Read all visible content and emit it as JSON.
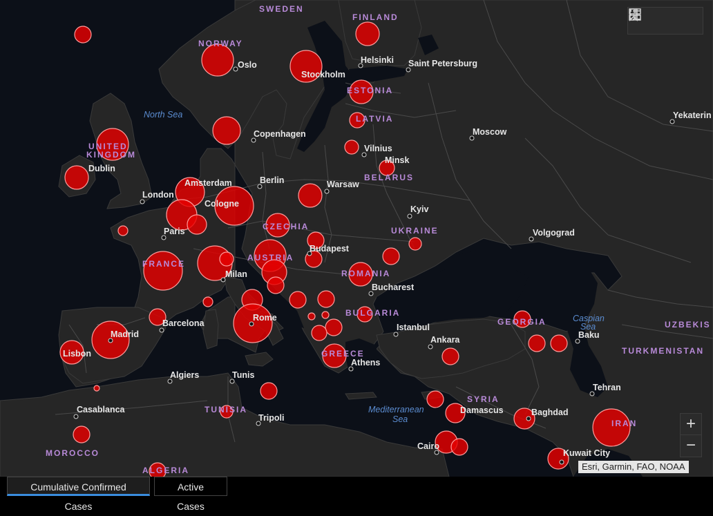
{
  "map": {
    "countries": [
      {
        "name": "SWEDEN"
      },
      {
        "name": "FINLAND"
      },
      {
        "name": "NORWAY"
      },
      {
        "name": "ESTONIA"
      },
      {
        "name": "LATVIA"
      },
      {
        "name": "UNITED"
      },
      {
        "name": "KINGDOM"
      },
      {
        "name": "BELARUS"
      },
      {
        "name": "UKRAINE"
      },
      {
        "name": "CZECHIA"
      },
      {
        "name": "AUSTRIA"
      },
      {
        "name": "FRANCE"
      },
      {
        "name": "ROMANIA"
      },
      {
        "name": "BULGARIA"
      },
      {
        "name": "GREECE"
      },
      {
        "name": "GEORGIA"
      },
      {
        "name": "UZBEKIS"
      },
      {
        "name": "TURKMENISTAN"
      },
      {
        "name": "SYRIA"
      },
      {
        "name": "TUNISIA"
      },
      {
        "name": "MOROCCO"
      },
      {
        "name": "IRAN"
      },
      {
        "name": "ALGERIA"
      }
    ],
    "cities": [
      "Oslo",
      "Helsinki",
      "Saint Petersburg",
      "Stockholm",
      "Yekaterin",
      "Copenhagen",
      "Moscow",
      "Vilnius",
      "Minsk",
      "Dublin",
      "Berlin",
      "Warsaw",
      "London",
      "Amsterdam",
      "Cologne",
      "Kyiv",
      "Paris",
      "Volgograd",
      "Budapest",
      "Milan",
      "Bucharest",
      "Barcelona",
      "Rome",
      "Istanbul",
      "Madrid",
      "Baku",
      "Ankara",
      "Lisbon",
      "Athens",
      "Algiers",
      "Tunis",
      "Tehran",
      "Casablanca",
      "Tripoli",
      "Damascus",
      "Baghdad",
      "Cairo",
      "Kuwait City"
    ],
    "seas": [
      {
        "lines": [
          "North Sea"
        ]
      },
      {
        "lines": [
          "Caspian",
          "Sea"
        ]
      },
      {
        "lines": [
          "Mediterranean",
          "Sea"
        ]
      }
    ],
    "case_circle_count": 55
  },
  "colors": {
    "circle": "#e60000",
    "land": "#262626",
    "water": "#0c1018",
    "country_label": "#b88ad8"
  },
  "toolbar": {
    "icons": [
      "bookmark-icon",
      "legend-list-icon",
      "basemap-gallery-icon"
    ]
  },
  "zoom": {
    "in_label": "+",
    "out_label": "−"
  },
  "attribution": "Esri, Garmin, FAO, NOAA",
  "tabs": [
    {
      "label": "Cumulative Confirmed Cases",
      "active": true
    },
    {
      "label": "Active Cases",
      "active": false
    }
  ]
}
